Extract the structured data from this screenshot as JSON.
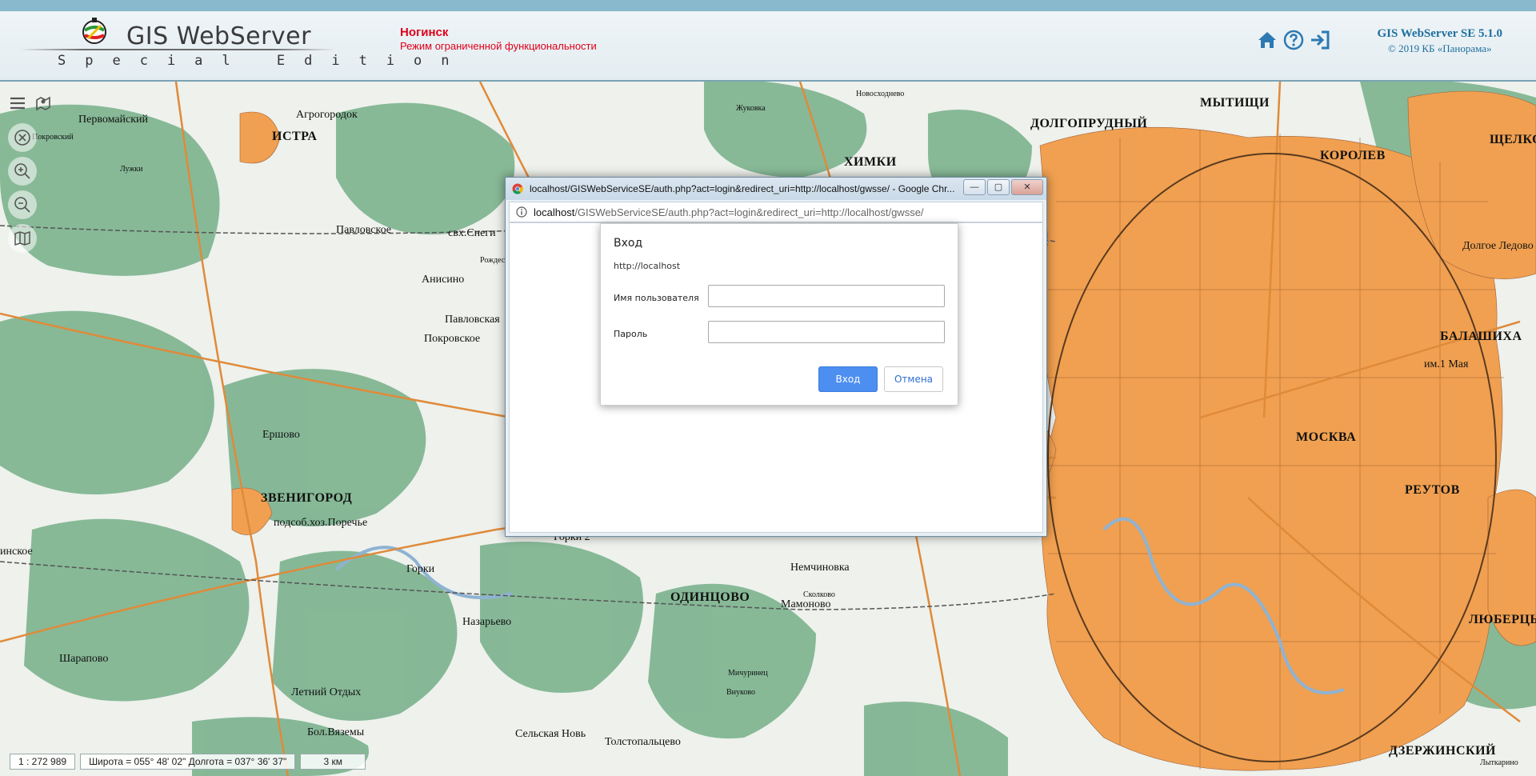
{
  "header": {
    "logo_title": "GIS WebServer",
    "logo_subtitle": "Special Edition",
    "project_name": "Ногинск",
    "project_mode": "Режим ограниченной функциональности",
    "version": "GIS WebServer SE 5.1.0",
    "copyright": "© 2019 КБ «Панорама»",
    "icons": [
      "home-icon",
      "help-icon",
      "login-icon"
    ]
  },
  "map": {
    "toolbar_icons": [
      "menu-icon",
      "map-marker-icon",
      "clear-icon",
      "zoom-in-icon",
      "zoom-out-icon",
      "map-layers-icon"
    ],
    "labels": [
      {
        "text": "МЫТИЩИ",
        "cls": "big"
      },
      {
        "text": "КОРОЛЕВ",
        "cls": "big"
      },
      {
        "text": "ЩЕЛКОВ",
        "cls": "big"
      },
      {
        "text": "ДОЛГОПРУДНЫЙ",
        "cls": "big"
      },
      {
        "text": "ХИМКИ",
        "cls": "big"
      },
      {
        "text": "БАЛАШИХА",
        "cls": "big"
      },
      {
        "text": "МОСКВА",
        "cls": "big"
      },
      {
        "text": "РЕУТОВ",
        "cls": "big"
      },
      {
        "text": "ЛЮБЕРЦЫ",
        "cls": "big"
      },
      {
        "text": "ДЗЕРЖИНСКИЙ",
        "cls": "big"
      },
      {
        "text": "ОДИНЦОВО",
        "cls": "big"
      },
      {
        "text": "ЗВЕНИГОРОД",
        "cls": "big"
      },
      {
        "text": "ИСТРА",
        "cls": "big"
      },
      {
        "text": "Первомайский",
        "cls": "mid"
      },
      {
        "text": "Агрогородок",
        "cls": "mid"
      },
      {
        "text": "Павловское",
        "cls": "mid"
      },
      {
        "text": "свх.Снеги",
        "cls": "mid"
      },
      {
        "text": "Анисино",
        "cls": "mid"
      },
      {
        "text": "Павловская",
        "cls": "mid"
      },
      {
        "text": "Покровское",
        "cls": "mid"
      },
      {
        "text": "Ершово",
        "cls": "mid"
      },
      {
        "text": "подсоб.хоз.Поречье",
        "cls": "mid"
      },
      {
        "text": "Горки",
        "cls": "mid"
      },
      {
        "text": "Назарьево",
        "cls": "mid"
      },
      {
        "text": "Шарапово",
        "cls": "mid"
      },
      {
        "text": "Летний Отдых",
        "cls": "mid"
      },
      {
        "text": "Бол.Вяземы",
        "cls": "mid"
      },
      {
        "text": "Немчиновка",
        "cls": "mid"
      },
      {
        "text": "Мамоново",
        "cls": "mid"
      },
      {
        "text": "Сельская Новь",
        "cls": "mid"
      },
      {
        "text": "Толстопальцево",
        "cls": "mid"
      },
      {
        "text": "Долгое Ледово",
        "cls": "mid"
      },
      {
        "text": "им.1 Мая",
        "cls": "mid"
      },
      {
        "text": "инское",
        "cls": "mid"
      },
      {
        "text": "Горки 2",
        "cls": "mid"
      },
      {
        "text": "Рождествено",
        "cls": "small"
      },
      {
        "text": "Лужки",
        "cls": "small"
      },
      {
        "text": "Покровский",
        "cls": "small"
      },
      {
        "text": "Жуковка",
        "cls": "small"
      },
      {
        "text": "Сколково",
        "cls": "small"
      },
      {
        "text": "Мичуринец",
        "cls": "small"
      },
      {
        "text": "Внуково",
        "cls": "small"
      },
      {
        "text": "Новосходнево",
        "cls": "small"
      },
      {
        "text": "Лыткарино",
        "cls": "small"
      }
    ]
  },
  "statusbar": {
    "scale": "1 : 272 989",
    "coords": "Широта = 055° 48' 02\"  Долгота = 037° 36' 37\"",
    "scale_bar": "3 км"
  },
  "popup": {
    "window_title": "localhost/GISWebServiceSE/auth.php?act=login&redirect_uri=http://localhost/gwsse/ - Google Chr...",
    "url_host": "localhost",
    "url_rest": "/GISWebServiceSE/auth.php?act=login&redirect_uri=http://localhost/gwsse/",
    "win_min": "—",
    "win_max": "▢",
    "win_close": "✕"
  },
  "login": {
    "title": "Вход",
    "host": "http://localhost",
    "username_label": "Имя пользователя",
    "username_value": "",
    "password_label": "Пароль",
    "password_value": "",
    "ok_label": "Вход",
    "cancel_label": "Отмена"
  }
}
